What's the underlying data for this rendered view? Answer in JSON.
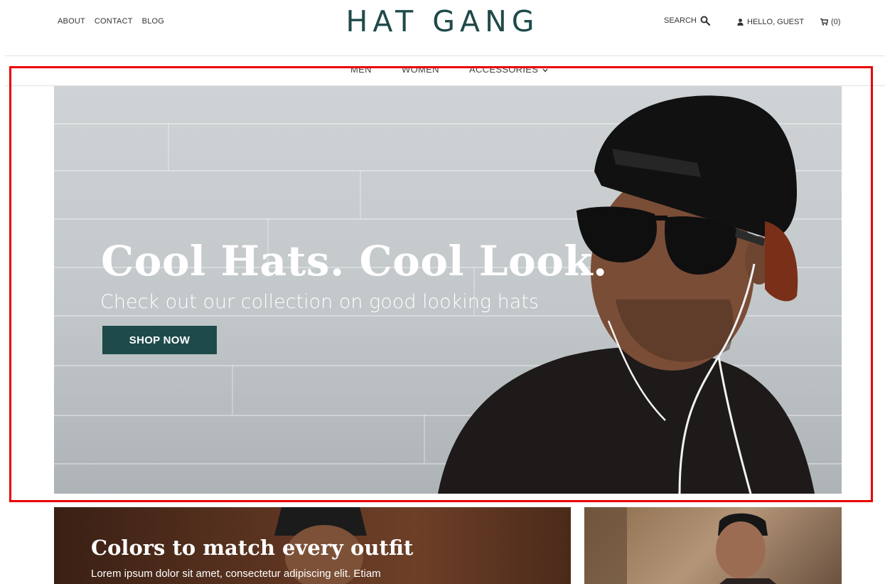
{
  "header": {
    "links": [
      "ABOUT",
      "CONTACT",
      "BLOG"
    ],
    "logo": "HAT GANG",
    "search_label": "SEARCH",
    "user_label": "HELLO, GUEST",
    "cart_label": "(0)"
  },
  "catnav": {
    "items": [
      "MEN",
      "WOMEN",
      "ACCESSORIES"
    ]
  },
  "hero": {
    "title": "Cool Hats. Cool Look.",
    "subtitle": "Check out our collection on good looking hats",
    "button_label": "SHOP NOW"
  },
  "promo": {
    "title": "Colors to match every outfit",
    "text": "Lorem ipsum dolor sit amet, consectetur adipiscing elit. Etiam"
  },
  "icons": {
    "search": "search-icon",
    "user": "user-icon",
    "cart": "cart-icon",
    "chevron": "chevron-down-icon"
  },
  "colors": {
    "brand": "#1f4a4a",
    "highlight": "#e80000"
  }
}
